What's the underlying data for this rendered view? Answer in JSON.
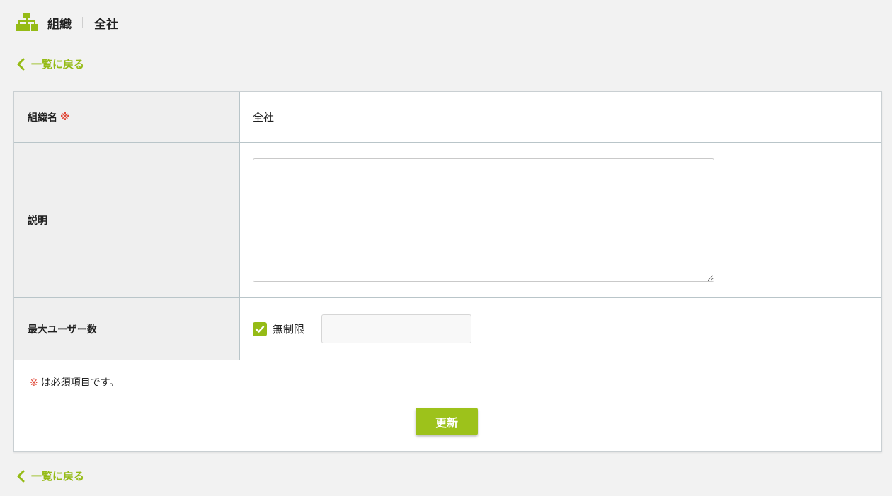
{
  "header": {
    "icon": "org-chart-icon",
    "title": "組織",
    "subtitle": "全社"
  },
  "nav": {
    "back_label": "一覧に戻る"
  },
  "form": {
    "name": {
      "label": "組織名",
      "required_mark": "※",
      "value": "全社"
    },
    "description": {
      "label": "説明",
      "value": ""
    },
    "max_users": {
      "label": "最大ユーザー数",
      "unlimited_label": "無制限",
      "unlimited_checked": true,
      "value": ""
    },
    "note": {
      "mark": "※",
      "text": "は必須項目です。"
    },
    "submit_label": "更新"
  },
  "colors": {
    "accent": "#95bb16",
    "button": "#9dc21b",
    "required": "#e04a3a",
    "label_bg": "#efefef",
    "page_bg": "#f2f2f2"
  }
}
